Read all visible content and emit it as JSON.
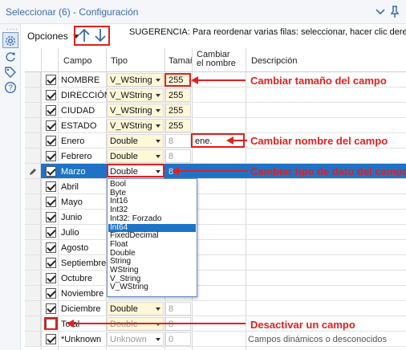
{
  "window": {
    "title": "Seleccionar (6) - Configuración"
  },
  "rail": {
    "icons": [
      "gear-icon",
      "refresh-icon",
      "tag-icon",
      "help-icon"
    ]
  },
  "toolbar": {
    "options_label": "Opciones",
    "hint": "SUGERENCIA: Para reordenar varias filas: seleccionar, hacer clic derecho y arras"
  },
  "table": {
    "headers": {
      "campo": "Campo",
      "tipo": "Tipo",
      "tamano": "Tamañ",
      "cambiar": "Cambiar\nel nombre",
      "cambiar_line1": "Cambiar",
      "cambiar_line2": "el nombre",
      "descripcion": "Descripción"
    },
    "rows": [
      {
        "checked": true,
        "name": "NOMBRE",
        "type": "V_WString",
        "size": "255",
        "rename": "",
        "desc": ""
      },
      {
        "checked": true,
        "name": "DIRECCIÓN",
        "type": "V_WString",
        "size": "255",
        "rename": "",
        "desc": ""
      },
      {
        "checked": true,
        "name": "CIUDAD",
        "type": "V_WString",
        "size": "255",
        "rename": "",
        "desc": ""
      },
      {
        "checked": true,
        "name": "ESTADO",
        "type": "V_WString",
        "size": "255",
        "rename": "",
        "desc": ""
      },
      {
        "checked": true,
        "name": "Enero",
        "type": "Double",
        "size": "8",
        "rename": "ene.",
        "desc": ""
      },
      {
        "checked": true,
        "name": "Febrero",
        "type": "Double",
        "size": "8",
        "rename": "",
        "desc": ""
      },
      {
        "checked": true,
        "name": "Marzo",
        "type": "Double",
        "size": "8",
        "rename": "",
        "desc": ""
      },
      {
        "checked": true,
        "name": "Abril",
        "type": "",
        "size": "",
        "rename": "",
        "desc": ""
      },
      {
        "checked": true,
        "name": "Mayo",
        "type": "",
        "size": "",
        "rename": "",
        "desc": ""
      },
      {
        "checked": true,
        "name": "Junio",
        "type": "",
        "size": "",
        "rename": "",
        "desc": ""
      },
      {
        "checked": true,
        "name": "Julio",
        "type": "",
        "size": "",
        "rename": "",
        "desc": ""
      },
      {
        "checked": true,
        "name": "Agosto",
        "type": "",
        "size": "",
        "rename": "",
        "desc": ""
      },
      {
        "checked": true,
        "name": "Septiembre",
        "type": "",
        "size": "",
        "rename": "",
        "desc": ""
      },
      {
        "checked": true,
        "name": "Octubre",
        "type": "",
        "size": "",
        "rename": "",
        "desc": ""
      },
      {
        "checked": true,
        "name": "Noviembre",
        "type": "",
        "size": "",
        "rename": "",
        "desc": ""
      },
      {
        "checked": true,
        "name": "Diciembre",
        "type": "Double",
        "size": "8",
        "rename": "",
        "desc": ""
      },
      {
        "checked": false,
        "name": "Total",
        "type": "Double",
        "size": "8",
        "rename": "",
        "desc": ""
      },
      {
        "checked": true,
        "name": "*Unknown",
        "type": "Unknown",
        "size": "0",
        "rename": "",
        "desc": "Campos dinámicos o desconocidos"
      }
    ]
  },
  "dropdown": {
    "options": [
      "Bool",
      "Byte",
      "Int16",
      "Int32",
      "Int32: Forzado",
      "Int64",
      "FixedDecimal",
      "Float",
      "Double",
      "String",
      "WString",
      "V_String",
      "V_WString"
    ],
    "highlighted": "Int64"
  },
  "annotations": {
    "size": "Cambiar tamaño del campo",
    "rename": "Cambiar nombre del campo",
    "type": "Cambiar tipo de dato del campo",
    "deactivate": "Desactivar un campo"
  },
  "colors": {
    "accent": "#1f73c6",
    "annotation": "#e02020",
    "editable_cell": "#fef7d8",
    "title": "#3d6ba8"
  }
}
